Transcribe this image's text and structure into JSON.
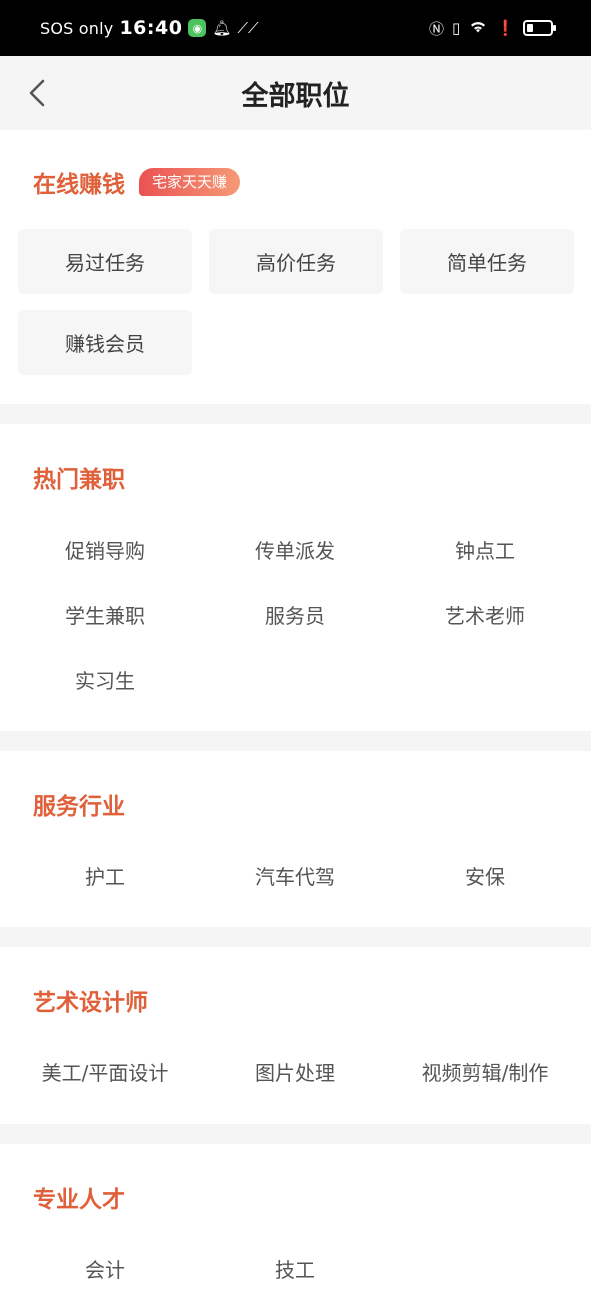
{
  "status_bar": {
    "carrier": "SOS only",
    "time": "16:40",
    "battery_level": 0.25
  },
  "header": {
    "title": "全部职位"
  },
  "sections": {
    "online": {
      "title": "在线赚钱",
      "tag": "宅家天天赚",
      "items": [
        "易过任务",
        "高价任务",
        "简单任务",
        "赚钱会员"
      ]
    },
    "hot": {
      "title": "热门兼职",
      "items": [
        "促销导购",
        "传单派发",
        "钟点工",
        "学生兼职",
        "服务员",
        "艺术老师",
        "实习生"
      ]
    },
    "service": {
      "title": "服务行业",
      "items": [
        "护工",
        "汽车代驾",
        "安保"
      ]
    },
    "art": {
      "title": "艺术设计师",
      "items": [
        "美工/平面设计",
        "图片处理",
        "视频剪辑/制作"
      ]
    },
    "pro": {
      "title": "专业人才",
      "items": [
        "会计",
        "技工"
      ]
    }
  },
  "colors": {
    "accent": "#e0603a",
    "tag_gradient_start": "#ea5252",
    "tag_gradient_end": "#f59a76",
    "page_bg": "#f5f5f5",
    "button_bg": "#f6f6f7"
  }
}
